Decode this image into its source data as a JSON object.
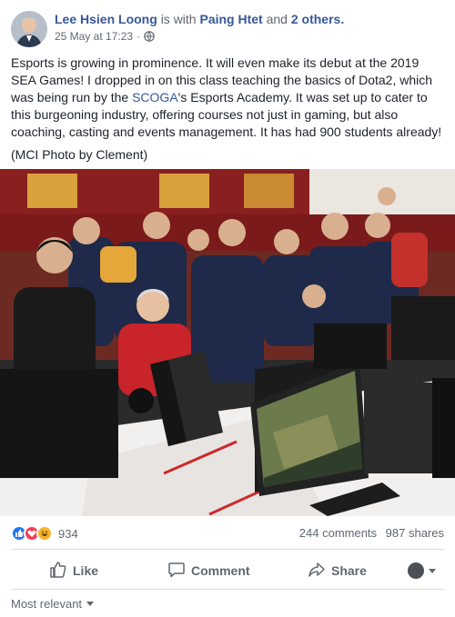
{
  "post": {
    "author": "Lee Hsien Loong",
    "with_text": "is with",
    "tagged_name": "Paing Htet",
    "and_text": "and",
    "others": "2 others.",
    "timestamp": "25 May at 17:23",
    "audience_icon": "globe-icon",
    "paragraph_1_before": "Esports is growing in prominence. It will even make its debut at the 2019 SEA Games! I dropped in on this class teaching the basics of Dota2, which was being run by the ",
    "paragraph_1_link": "SCOGA",
    "paragraph_1_after": "'s Esports Academy. It was set up to cater to this burgeoning industry, offering courses not just in gaming, but also coaching, casting and events management. It has had 900 students already!",
    "paragraph_2": "(MCI Photo by Clement)"
  },
  "stats": {
    "reaction_icons": [
      "like-icon",
      "love-icon",
      "haha-icon"
    ],
    "reaction_count": "934",
    "comments": "244 comments",
    "shares": "987 shares"
  },
  "actions": {
    "like_label": "Like",
    "comment_label": "Comment",
    "share_label": "Share"
  },
  "comments_filter": {
    "label": "Most relevant"
  },
  "colors": {
    "link": "#385898",
    "secondary_text": "#606770",
    "divider": "#dadde1",
    "like_blue": "#2078f4",
    "love_red": "#f33e58",
    "haha_yellow": "#f7b125"
  }
}
